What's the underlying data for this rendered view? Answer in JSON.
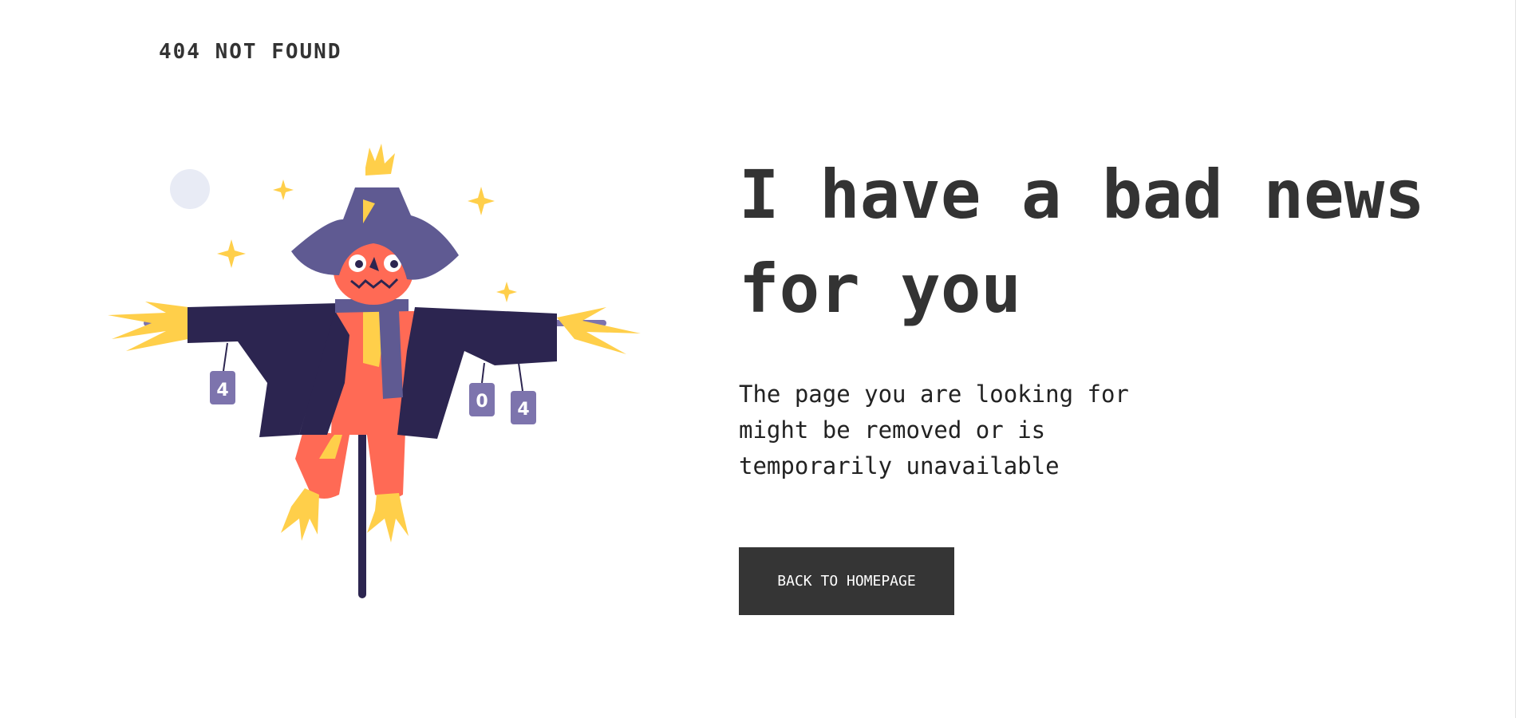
{
  "brand": {
    "label": "404 NOT FOUND"
  },
  "headline": {
    "text": "I have a bad news for you"
  },
  "description": {
    "text": "The page you are looking for might be removed or is temporarily unavailable"
  },
  "home_button": {
    "label": "BACK TO HOMEPAGE"
  },
  "illustration": {
    "icon": "scarecrow-illustration",
    "cans": [
      "4",
      "0",
      "4"
    ],
    "colors": {
      "hat": "#5f5a92",
      "coat": "#2c2550",
      "pumpkin": "#ff6a55",
      "straw": "#ffcf4a",
      "can": "#7d74ad",
      "moon": "#e8ebf5"
    }
  },
  "colors": {
    "text": "#333333",
    "button_bg": "#353535",
    "button_text": "#ffffff",
    "background": "#ffffff"
  }
}
